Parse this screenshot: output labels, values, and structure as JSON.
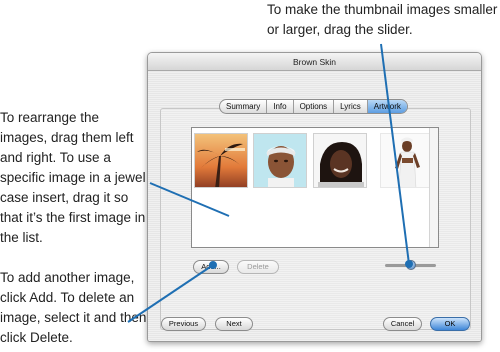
{
  "window": {
    "title": "Brown Skin"
  },
  "tabs": [
    {
      "label": "Summary",
      "selected": false
    },
    {
      "label": "Info",
      "selected": false
    },
    {
      "label": "Options",
      "selected": false
    },
    {
      "label": "Lyrics",
      "selected": false
    },
    {
      "label": "Artwork",
      "selected": true
    }
  ],
  "artwork": {
    "images": [
      {
        "name": "album-cover-palm"
      },
      {
        "name": "album-cover-portrait-bandana"
      },
      {
        "name": "album-cover-portrait-smile"
      },
      {
        "name": "album-cover-portrait-standing"
      }
    ]
  },
  "buttons": {
    "add": "Add...",
    "delete": "Delete",
    "previous": "Previous",
    "next": "Next",
    "cancel": "Cancel",
    "ok": "OK"
  },
  "slider": {
    "value_fraction": 0.5
  },
  "callouts": {
    "top": "To make the thumbnail images smaller or larger, drag the slider.",
    "left_top": "To rearrange the images, drag them left and right. To use a specific image in a jewel case insert, drag it so that it’s the first image in the list.",
    "left_bottom": "To add another image, click Add. To delete an image, select it and then click Delete."
  },
  "colors": {
    "callout_line": "#1f6fb3",
    "selected_tab": "#5d9ee2",
    "ok_button": "#3e86d8"
  }
}
